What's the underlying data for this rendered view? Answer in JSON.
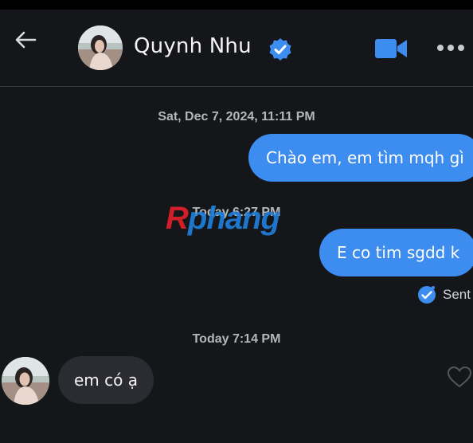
{
  "header": {
    "contact_name": "Quynh Nhu",
    "verified": true,
    "icons": [
      "back-arrow-icon",
      "verified-icon",
      "video-camera-icon",
      "more-icon"
    ]
  },
  "messages": [
    {
      "type": "timestamp",
      "text": "Sat, Dec 7, 2024, 11:11 PM"
    },
    {
      "type": "outgoing",
      "text": "Chào em, em tìm mqh gì"
    },
    {
      "type": "timestamp",
      "text": "Today 6:27 PM"
    },
    {
      "type": "outgoing",
      "text": "E co tim sgdd k",
      "status": "Sent"
    },
    {
      "type": "timestamp",
      "text": "Today 7:14 PM"
    },
    {
      "type": "incoming",
      "text": "em có ạ"
    }
  ],
  "watermark": {
    "first": "R",
    "rest": "phang"
  },
  "colors": {
    "background": "#15161a",
    "outgoing_bubble": "#3d8cf0",
    "incoming_bubble": "#2b2c31",
    "accent": "#3d8cf0"
  }
}
